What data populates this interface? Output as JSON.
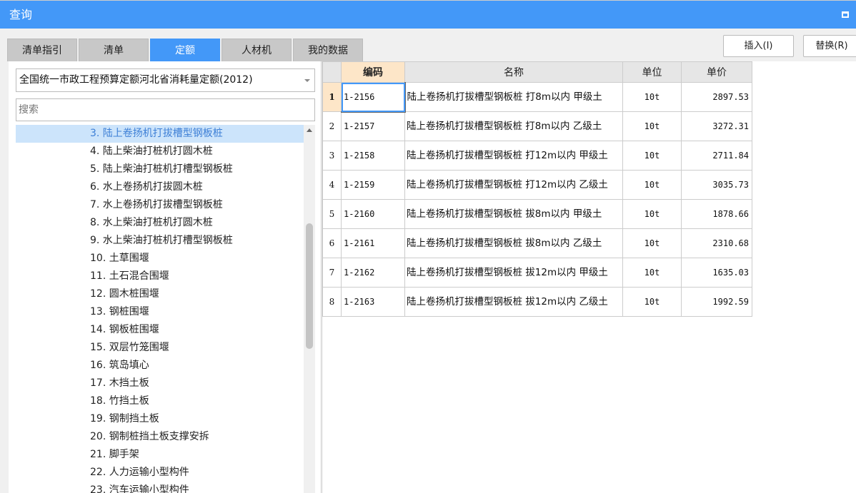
{
  "window": {
    "title": "查询"
  },
  "tabs": [
    "清单指引",
    "清单",
    "定额",
    "人材机",
    "我的数据"
  ],
  "active_tab": 2,
  "buttons": {
    "insert": "插入(I)",
    "replace": "替换(R)"
  },
  "left": {
    "dropdown_value": "全国统一市政工程预算定额河北省消耗量定额(2012)",
    "search_placeholder": "搜索",
    "items": [
      "3. 陆上卷扬机打拔槽型钢板桩",
      "4. 陆上柴油打桩机打圆木桩",
      "5. 陆上柴油打桩机打槽型钢板桩",
      "6. 水上卷扬机打拔圆木桩",
      "7. 水上卷扬机打拔槽型钢板桩",
      "8. 水上柴油打桩机打圆木桩",
      "9. 水上柴油打桩机打槽型钢板桩",
      "10. 土草围堰",
      "11. 土石混合围堰",
      "12. 圆木桩围堰",
      "13. 钢桩围堰",
      "14. 钢板桩围堰",
      "15. 双层竹笼围堰",
      "16. 筑岛填心",
      "17. 木挡土板",
      "18. 竹挡土板",
      "19. 钢制挡土板",
      "20. 钢制桩挡土板支撑安拆",
      "21. 脚手架",
      "22. 人力运输小型构件",
      "23. 汽车运输小型构件"
    ]
  },
  "table": {
    "headers": [
      "编码",
      "名称",
      "单位",
      "单价"
    ],
    "rows": [
      {
        "n": "1",
        "code": "1-2156",
        "name": "陆上卷扬机打拔槽型钢板桩 打8m以内 甲级土",
        "unit": "10t",
        "price": "2897.53"
      },
      {
        "n": "2",
        "code": "1-2157",
        "name": "陆上卷扬机打拔槽型钢板桩 打8m以内 乙级土",
        "unit": "10t",
        "price": "3272.31"
      },
      {
        "n": "3",
        "code": "1-2158",
        "name": "陆上卷扬机打拔槽型钢板桩 打12m以内 甲级土",
        "unit": "10t",
        "price": "2711.84"
      },
      {
        "n": "4",
        "code": "1-2159",
        "name": "陆上卷扬机打拔槽型钢板桩 打12m以内 乙级土",
        "unit": "10t",
        "price": "3035.73"
      },
      {
        "n": "5",
        "code": "1-2160",
        "name": "陆上卷扬机打拔槽型钢板桩 拔8m以内 甲级土",
        "unit": "10t",
        "price": "1878.66"
      },
      {
        "n": "6",
        "code": "1-2161",
        "name": "陆上卷扬机打拔槽型钢板桩 拔8m以内 乙级土",
        "unit": "10t",
        "price": "2310.68"
      },
      {
        "n": "7",
        "code": "1-2162",
        "name": "陆上卷扬机打拔槽型钢板桩 拔12m以内 甲级土",
        "unit": "10t",
        "price": "1635.03"
      },
      {
        "n": "8",
        "code": "1-2163",
        "name": "陆上卷扬机打拔槽型钢板桩 拔12m以内 乙级土",
        "unit": "10t",
        "price": "1992.59"
      }
    ]
  }
}
